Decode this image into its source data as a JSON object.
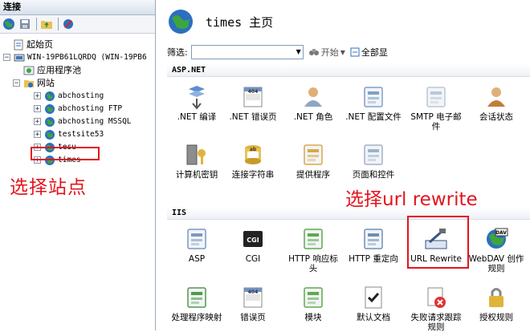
{
  "left_pane": {
    "title": "连接",
    "tree": [
      {
        "id": "start",
        "label": "起始页"
      },
      {
        "id": "server",
        "label": "WIN-19PB61LQRDQ (WIN-19PB6"
      },
      {
        "id": "apppools",
        "label": "应用程序池"
      },
      {
        "id": "sites",
        "label": "网站"
      },
      {
        "id": "abchosting",
        "label": "abchosting"
      },
      {
        "id": "abchosting-ftp",
        "label": "abchosting FTP"
      },
      {
        "id": "abchosting-mssql",
        "label": "abchosting MSSQL"
      },
      {
        "id": "testsite53",
        "label": "testsite53"
      },
      {
        "id": "tesu",
        "label": "tesu"
      },
      {
        "id": "times",
        "label": "times"
      }
    ],
    "annotation": "选择站点"
  },
  "main": {
    "title": "times 主页",
    "filter_label": "筛选:",
    "start_button": "开始",
    "show_all_button": "全部显",
    "groups": [
      {
        "name": "ASP.NET",
        "items": [
          {
            "label": ".NET 编译",
            "icon": "compile-icon"
          },
          {
            "label": ".NET 错误页",
            "icon": "error-page-icon",
            "badge": "404"
          },
          {
            "label": ".NET 角色",
            "icon": "roles-icon"
          },
          {
            "label": ".NET 配置文件",
            "icon": "profile-icon"
          },
          {
            "label": "SMTP 电子邮件",
            "icon": "smtp-icon"
          },
          {
            "label": "会话状态",
            "icon": "session-icon"
          },
          {
            "label": "计算机密钥",
            "icon": "machine-key-icon"
          },
          {
            "label": "连接字符串",
            "icon": "connection-string-icon",
            "badge": "ab"
          },
          {
            "label": "提供程序",
            "icon": "providers-icon"
          },
          {
            "label": "页面和控件",
            "icon": "pages-controls-icon"
          }
        ]
      },
      {
        "name": "IIS",
        "items": [
          {
            "label": "ASP",
            "icon": "asp-icon"
          },
          {
            "label": "CGI",
            "icon": "cgi-icon",
            "badge": "CGI"
          },
          {
            "label": "HTTP 响应标头",
            "icon": "http-headers-icon"
          },
          {
            "label": "HTTP 重定向",
            "icon": "http-redirect-icon"
          },
          {
            "label": "URL Rewrite",
            "icon": "url-rewrite-icon"
          },
          {
            "label": "WebDAV 创作规则",
            "icon": "webdav-icon",
            "badge": "DAV"
          },
          {
            "label": "处理程序映射",
            "icon": "handler-mappings-icon"
          },
          {
            "label": "错误页",
            "icon": "error-pages-icon",
            "badge": "404"
          },
          {
            "label": "模块",
            "icon": "modules-icon"
          },
          {
            "label": "默认文档",
            "icon": "default-document-icon"
          },
          {
            "label": "失败请求跟踪规则",
            "icon": "failed-request-icon"
          },
          {
            "label": "授权规则",
            "icon": "authorization-icon"
          }
        ]
      }
    ],
    "annotation": "选择url rewrite"
  },
  "colors": {
    "annotation_red": "#e3141d",
    "globe_blue": "#2c6fbf",
    "globe_green": "#3ea53e"
  }
}
